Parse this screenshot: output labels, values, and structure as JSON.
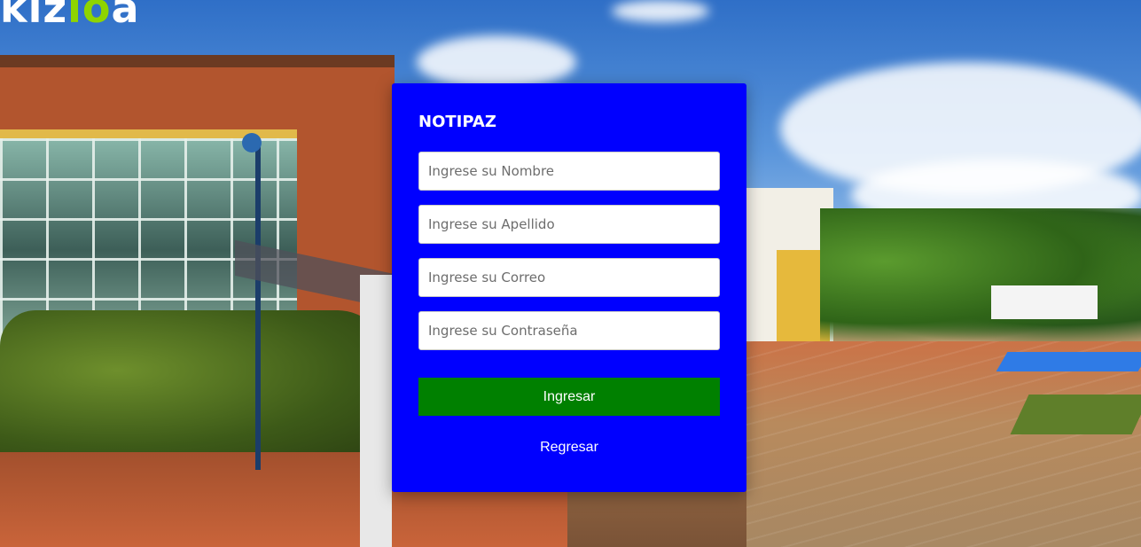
{
  "logo": {
    "prefix": "kiz",
    "accent": "io",
    "suffix": "a"
  },
  "login": {
    "title": "NOTIPAZ",
    "name_placeholder": "Ingrese su Nombre",
    "lastname_placeholder": "Ingrese su Apellido",
    "email_placeholder": "Ingrese su Correo",
    "password_placeholder": "Ingrese su Contraseña",
    "submit_label": "Ingresar",
    "back_label": "Regresar"
  },
  "colors": {
    "card_background": "#0000ff",
    "submit_background": "#008000",
    "logo_accent": "#8fd400"
  }
}
